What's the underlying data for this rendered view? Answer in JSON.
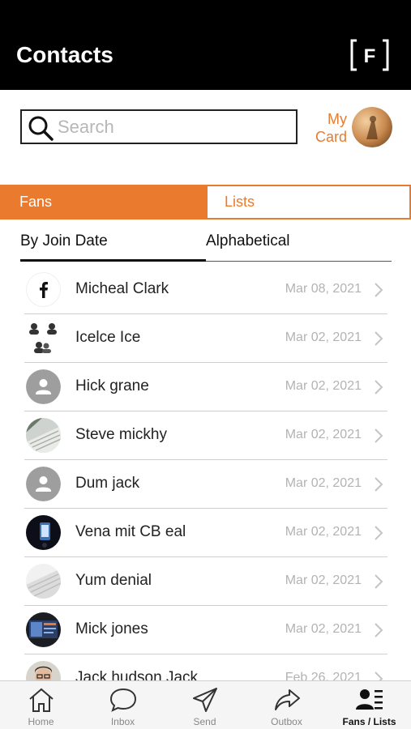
{
  "header": {
    "title": "Contacts",
    "logo_letter": "F"
  },
  "search": {
    "placeholder": "Search",
    "value": ""
  },
  "my_card": {
    "label_line1": "My",
    "label_line2": "Card"
  },
  "tabs": [
    {
      "label": "Fans",
      "active": true
    },
    {
      "label": "Lists",
      "active": false
    }
  ],
  "sort": {
    "options": [
      "By Join Date",
      "Alphabetical"
    ],
    "selected": "By Join Date"
  },
  "contacts": [
    {
      "name": "Micheal Clark",
      "date": "Mar 08, 2021",
      "avatar": "facebook-icon"
    },
    {
      "name": "Icelce Ice",
      "date": "Mar 02, 2021",
      "avatar": "group-avatar"
    },
    {
      "name": "Hick grane",
      "date": "Mar 02, 2021",
      "avatar": "default-person-icon"
    },
    {
      "name": "Steve mickhy",
      "date": "Mar 02, 2021",
      "avatar": "photo-keyboard"
    },
    {
      "name": "Dum jack",
      "date": "Mar 02, 2021",
      "avatar": "default-person-icon"
    },
    {
      "name": "Vena mit CB eal",
      "date": "Mar 02, 2021",
      "avatar": "photo-phone"
    },
    {
      "name": "Yum denial",
      "date": "Mar 02, 2021",
      "avatar": "photo-keyboard"
    },
    {
      "name": "Mick jones",
      "date": "Mar 02, 2021",
      "avatar": "photo-laptop"
    },
    {
      "name": "Jack hudson Jack",
      "date": "Feb 26, 2021",
      "avatar": "photo-person"
    }
  ],
  "tabbar": [
    {
      "label": "Home",
      "icon": "home-icon"
    },
    {
      "label": "Inbox",
      "icon": "chat-bubble-icon"
    },
    {
      "label": "Send",
      "icon": "paper-plane-icon"
    },
    {
      "label": "Outbox",
      "icon": "share-arrow-icon"
    },
    {
      "label": "Fans / Lists",
      "icon": "contacts-list-icon",
      "active": true
    }
  ],
  "colors": {
    "accent": "#ea7a2e",
    "header_bg": "#000000",
    "muted_text": "#b3b3b3"
  }
}
